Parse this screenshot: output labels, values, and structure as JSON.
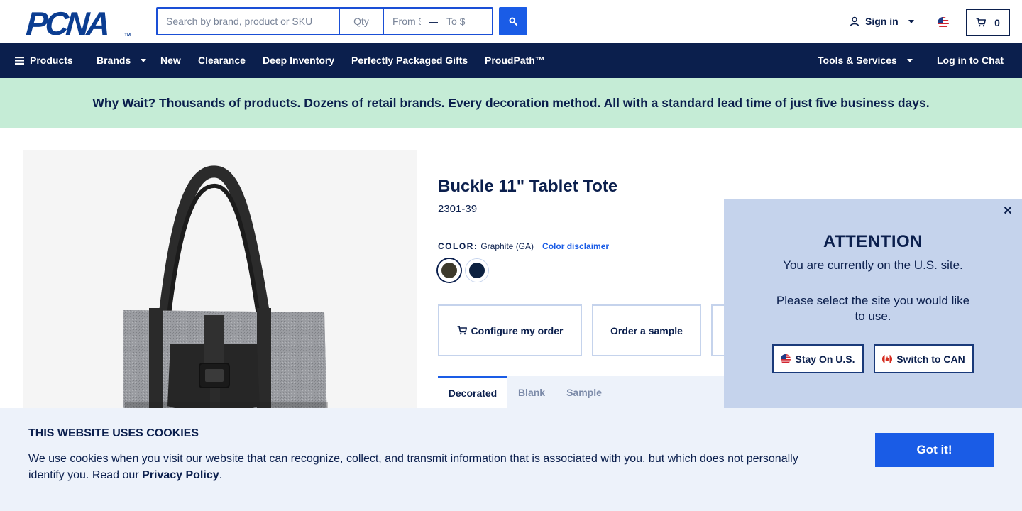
{
  "header": {
    "logo_text": "PCNA",
    "logo_tm": "TM",
    "search_placeholder": "Search by brand, product or SKU",
    "qty_placeholder": "Qty",
    "from_placeholder": "From $",
    "price_separator": "—",
    "to_placeholder": "To $",
    "signin_label": "Sign in",
    "cart_count": "0"
  },
  "nav": {
    "products": "Products",
    "brands": "Brands",
    "new": "New",
    "clearance": "Clearance",
    "deep_inventory": "Deep Inventory",
    "gifts": "Perfectly Packaged Gifts",
    "proudpath": "ProudPath™",
    "tools": "Tools & Services",
    "chat": "Log in to Chat"
  },
  "promo": {
    "text": "Why Wait? Thousands of products. Dozens of retail brands. Every decoration method. All with a standard lead time of just five business days."
  },
  "product": {
    "title": "Buckle 11\" Tablet Tote",
    "sku": "2301-39",
    "color_label": "COLOR:",
    "color_value": "Graphite (GA)",
    "color_disclaimer": "Color disclaimer",
    "swatches": [
      {
        "name": "Graphite",
        "color": "#3d3a2c"
      },
      {
        "name": "Navy",
        "color": "#0e2240"
      }
    ],
    "actions": {
      "configure": "Configure my order",
      "sample": "Order a sample"
    },
    "tabs": [
      "Decorated",
      "Blank",
      "Sample"
    ]
  },
  "popup": {
    "title": "ATTENTION",
    "line1": "You are currently on the U.S. site.",
    "line2": "Please select the site you would like to use.",
    "stay": "Stay On U.S.",
    "switch": "Switch to CAN",
    "close_glyph": "✕"
  },
  "cookie": {
    "title": "THIS WEBSITE USES COOKIES",
    "text_before": "We use cookies when you visit our website that can recognize, collect, and transmit information that is associated with you, but which does not personally identify you. Read our ",
    "link": "Privacy Policy",
    "text_after": ".",
    "button": "Got it!"
  },
  "colors": {
    "navy": "#0b1f4d",
    "blue": "#1a5ce6",
    "promo_bg": "#c5ecd6",
    "popup_bg": "#c5d3ec",
    "cookie_bg": "#edf2fa"
  }
}
